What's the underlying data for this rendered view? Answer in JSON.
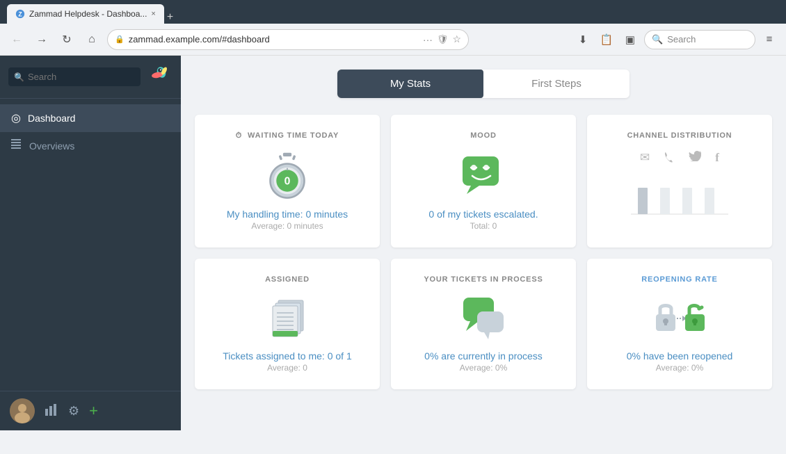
{
  "browser": {
    "tab_title": "Zammad Helpdesk - Dashboa...",
    "tab_close": "×",
    "tab_plus": "+",
    "nav_back": "←",
    "nav_forward": "→",
    "nav_refresh": "↻",
    "nav_home": "⌂",
    "address": "zammad.example.com/#dashboard",
    "toolbar_search_placeholder": "Search",
    "toolbar_more": "···",
    "bookmark_icon": "☆",
    "shield_icon": "🛡",
    "download_icon": "⬇",
    "reading_icon": "📖",
    "sidepanel_icon": "▣",
    "menu_icon": "≡"
  },
  "sidebar": {
    "search_placeholder": "Search",
    "nav_items": [
      {
        "id": "dashboard",
        "label": "Dashboard",
        "icon": "◎"
      },
      {
        "id": "overviews",
        "label": "Overviews",
        "icon": "≡"
      }
    ],
    "bottom": {
      "avatar_initials": "",
      "stats_icon": "📊",
      "settings_icon": "⚙",
      "add_icon": "+"
    }
  },
  "tabs": [
    {
      "id": "my-stats",
      "label": "My Stats",
      "active": true
    },
    {
      "id": "first-steps",
      "label": "First Steps",
      "active": false
    }
  ],
  "stats": {
    "waiting_time": {
      "title": "WAITING TIME TODAY",
      "value": "0",
      "main_text": "My handling time: 0 minutes",
      "sub_text": "Average: 0 minutes"
    },
    "mood": {
      "title": "MOOD",
      "main_text": "0 of my tickets escalated.",
      "sub_text": "Total: 0"
    },
    "channel_distribution": {
      "title": "CHANNEL DISTRIBUTION",
      "channels": [
        "✉",
        "✆",
        "🐦",
        "f"
      ],
      "bars": [
        {
          "height": 40,
          "label": "email"
        },
        {
          "height": 40,
          "label": "phone"
        },
        {
          "height": 40,
          "label": "twitter"
        },
        {
          "height": 40,
          "label": "facebook"
        }
      ]
    },
    "assigned": {
      "title": "ASSIGNED",
      "main_text": "Tickets assigned to me: 0 of 1",
      "sub_text": "Average: 0"
    },
    "tickets_in_process": {
      "title": "YOUR TICKETS IN PROCESS",
      "main_text": "0% are currently in process",
      "sub_text": "Average: 0%"
    },
    "reopening_rate": {
      "title": "REOPENING RATE",
      "title_color": "blue",
      "main_text": "0% have been reopened",
      "sub_text": "Average: 0%"
    }
  }
}
